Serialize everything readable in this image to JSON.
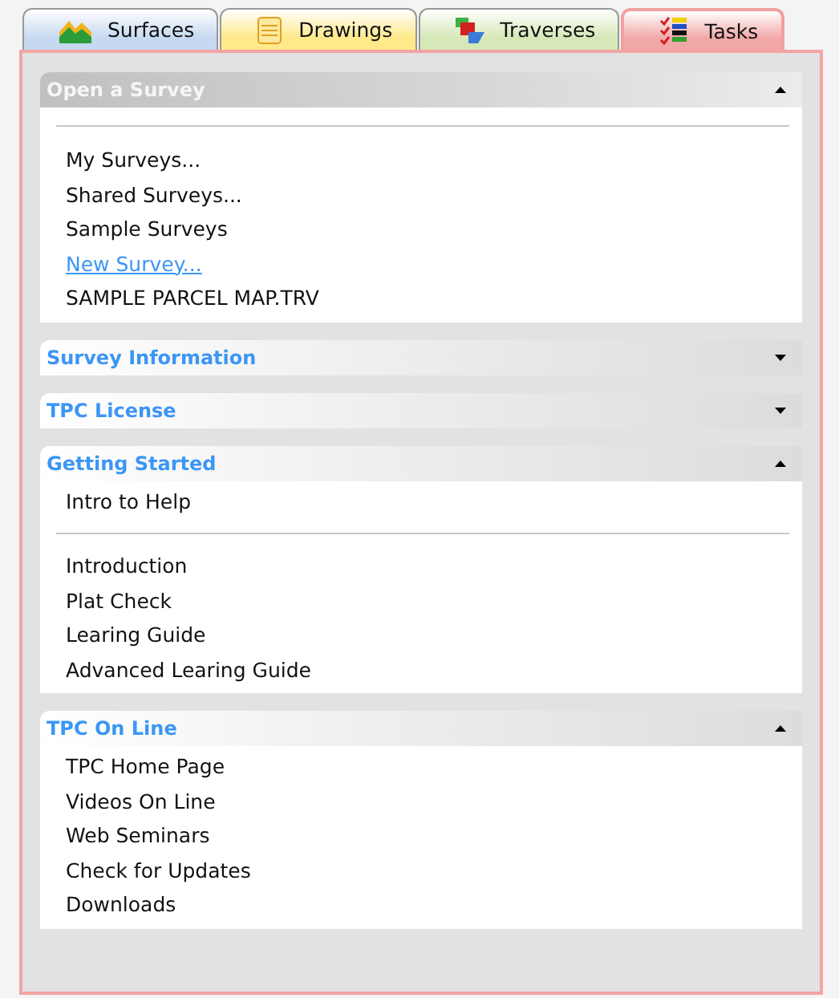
{
  "tabs": [
    {
      "label": "Surfaces",
      "color": "#c6d9f0",
      "selected": false
    },
    {
      "label": "Drawings",
      "color": "#ffe98a",
      "selected": false
    },
    {
      "label": "Traverses",
      "color": "#d6e8b8",
      "selected": false
    },
    {
      "label": "Tasks",
      "color": "#f2a7a7",
      "selected": true
    }
  ],
  "sections": [
    {
      "title": "Open a Survey",
      "disabled": true,
      "expanded": true,
      "leading_divider": true,
      "groups": [
        [
          {
            "label": "My Surveys...",
            "kind": "plain"
          },
          {
            "label": "Shared Surveys...",
            "kind": "plain"
          },
          {
            "label": "Sample Surveys",
            "kind": "plain"
          },
          {
            "label": "New Survey...",
            "kind": "link"
          },
          {
            "label": "SAMPLE PARCEL MAP.TRV",
            "kind": "plain"
          }
        ]
      ]
    },
    {
      "title": "Survey Information",
      "disabled": false,
      "expanded": false
    },
    {
      "title": "TPC License",
      "disabled": false,
      "expanded": false
    },
    {
      "title": "Getting Started",
      "disabled": false,
      "expanded": true,
      "groups": [
        [
          {
            "label": "Intro to Help",
            "kind": "plain"
          }
        ],
        [
          {
            "label": "Introduction",
            "kind": "plain"
          },
          {
            "label": "Plat Check",
            "kind": "plain"
          },
          {
            "label": "Learing Guide",
            "kind": "plain"
          },
          {
            "label": "Advanced Learing Guide",
            "kind": "plain"
          }
        ]
      ]
    },
    {
      "title": "TPC On Line",
      "disabled": false,
      "expanded": true,
      "groups": [
        [
          {
            "label": "TPC Home Page",
            "kind": "plain"
          },
          {
            "label": "Videos On Line",
            "kind": "plain"
          },
          {
            "label": "Web Seminars",
            "kind": "plain"
          },
          {
            "label": "Check for Updates",
            "kind": "plain"
          },
          {
            "label": "Downloads",
            "kind": "plain"
          }
        ]
      ]
    }
  ]
}
